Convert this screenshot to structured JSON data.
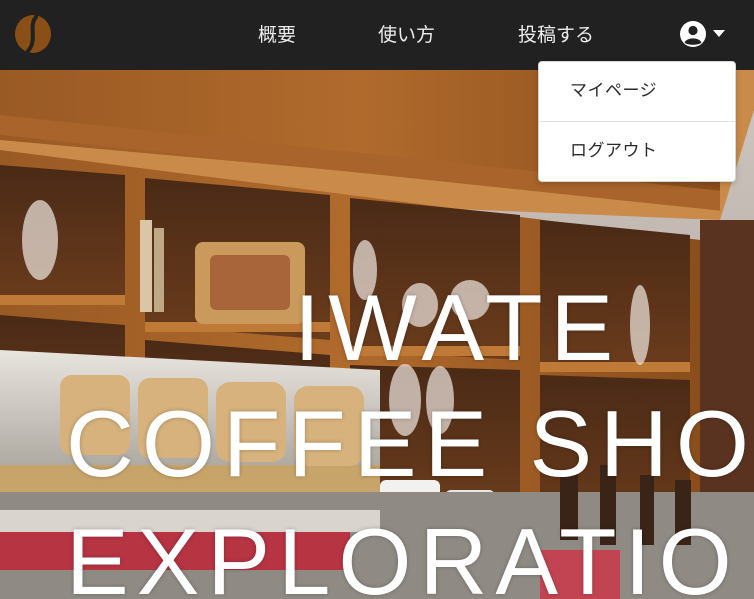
{
  "navbar": {
    "logo_icon": "coffee-bean-icon",
    "links": [
      {
        "label": "概要"
      },
      {
        "label": "使い方"
      },
      {
        "label": "投稿する"
      }
    ],
    "user_icon": "user-circle-icon",
    "caret_icon": "caret-down-icon"
  },
  "user_menu": {
    "items": [
      {
        "label": "マイページ"
      },
      {
        "label": "ログアウト"
      }
    ]
  },
  "hero": {
    "title_lines": [
      "IWATE",
      "COFFEE SHO",
      "EXPLORATIO"
    ]
  },
  "colors": {
    "navbar_bg": "#212121",
    "logo_brown": "#8a4e17",
    "dropdown_bg": "#ffffff",
    "hero_text": "#ffffff"
  }
}
